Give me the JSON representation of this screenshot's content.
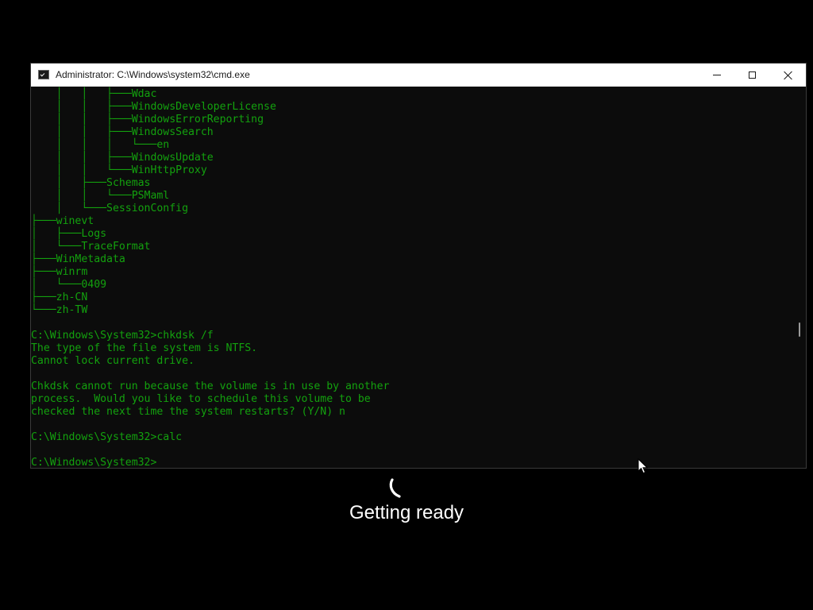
{
  "window": {
    "title": "Administrator: C:\\Windows\\system32\\cmd.exe",
    "icon": "cmd-icon",
    "controls": {
      "minimize": "minimize-icon",
      "maximize": "maximize-icon",
      "close": "close-icon"
    }
  },
  "console": {
    "text_color": "#13a10e",
    "background": "#0c0c0c",
    "lines": [
      "    │   │   ├───Wdac",
      "    │   │   ├───WindowsDeveloperLicense",
      "    │   │   ├───WindowsErrorReporting",
      "    │   │   ├───WindowsSearch",
      "    │   │   │   └───en",
      "    │   │   ├───WindowsUpdate",
      "    │   │   └───WinHttpProxy",
      "    │   ├───Schemas",
      "    │   │   └───PSMaml",
      "    │   └───SessionConfig",
      "├───winevt",
      "│   ├───Logs",
      "│   └───TraceFormat",
      "├───WinMetadata",
      "├───winrm",
      "│   └───0409",
      "├───zh-CN",
      "└───zh-TW",
      "",
      "C:\\Windows\\System32>chkdsk /f",
      "The type of the file system is NTFS.",
      "Cannot lock current drive.",
      "",
      "Chkdsk cannot run because the volume is in use by another",
      "process.  Would you like to schedule this volume to be",
      "checked the next time the system restarts? (Y/N) n",
      "",
      "C:\\Windows\\System32>calc",
      "",
      "C:\\Windows\\System32>"
    ]
  },
  "overlay": {
    "status_text": "Getting ready",
    "spinner_icon": "loading-spinner-icon",
    "text_color": "#ffffff"
  },
  "cursor": {
    "icon": "mouse-pointer-icon"
  }
}
